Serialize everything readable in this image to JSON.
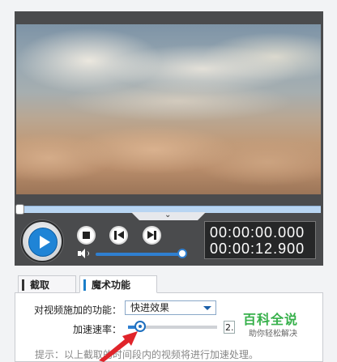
{
  "player": {
    "collapse_glyph": "⌄",
    "time_current": "00:00:00.000",
    "time_total": "00:00:12.900",
    "volume_level": 0.95,
    "playback_progress": 0.0
  },
  "icons": {
    "play": "play-icon",
    "stop": "stop-icon",
    "previous": "previous-icon",
    "next": "next-icon",
    "volume": "speaker-icon"
  },
  "tabs": [
    {
      "label": "截取",
      "active": false
    },
    {
      "label": "魔术功能",
      "active": true
    }
  ],
  "magic": {
    "function_label": "对视频施加的功能：",
    "function_value": "快进效果",
    "speed_label": "加速速率：",
    "speed_value": "2.",
    "tip": "提示：以上截取的时间段内的视频将进行加速处理。"
  },
  "watermark": {
    "brand": "百科全说",
    "slogan": "助你轻松解决"
  },
  "colors": {
    "accent": "#1f84d6",
    "panel": "#4a4b4d",
    "brand_green": "#36b04a",
    "annotation_arrow": "#e0242a"
  }
}
